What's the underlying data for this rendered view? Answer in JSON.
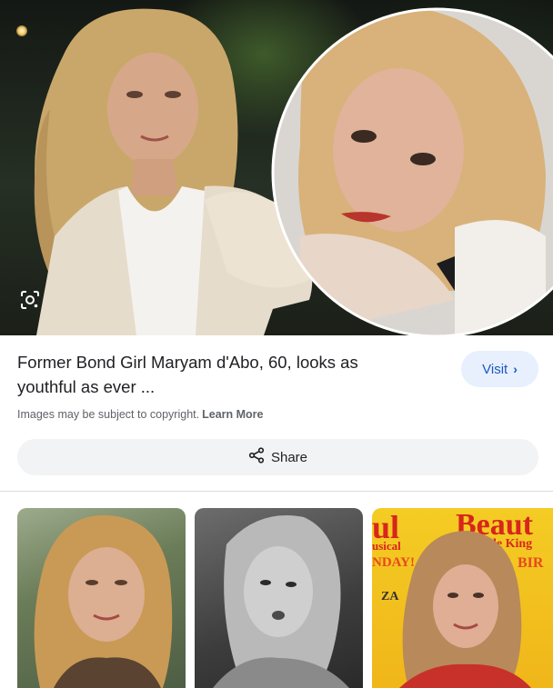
{
  "result": {
    "title": "Former Bond Girl Maryam d'Abo, 60, looks as youthful as ever ...",
    "visit_label": "Visit",
    "copyright_text": "Images may be subject to copyright.",
    "learn_more_label": "Learn More",
    "share_label": "Share"
  },
  "icons": {
    "lens": "google-lens-icon",
    "visit_chevron": "chevron-right-icon",
    "share": "share-icon"
  },
  "colors": {
    "visit_bg": "#e8f0fe",
    "visit_text": "#1a57c4",
    "share_bg": "#f1f3f4",
    "poster_bg": "#f4cc24",
    "poster_text": "#d7261b"
  },
  "related": {
    "poster_words": [
      "ul",
      "Beaut",
      "usical",
      "ole King",
      "NDAY!",
      "BIR",
      "ZA"
    ]
  }
}
